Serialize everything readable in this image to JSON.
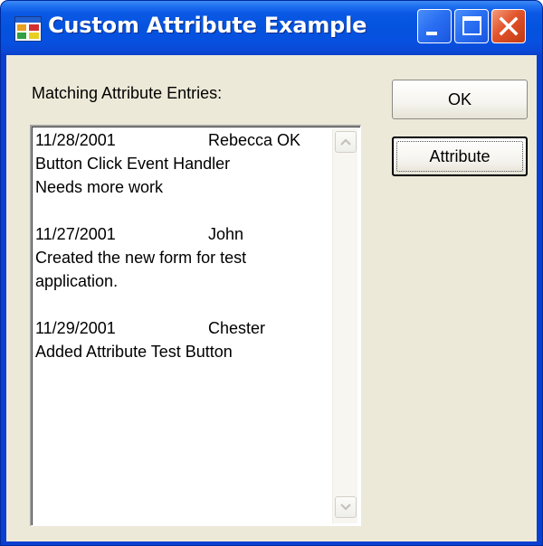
{
  "window": {
    "title": "Custom Attribute Example",
    "icon": "form-icon",
    "controls": {
      "minimize_icon": "minimize-icon",
      "maximize_icon": "maximize-icon",
      "close_icon": "close-icon"
    }
  },
  "form": {
    "label": "Matching Attribute Entries:",
    "entries": [
      {
        "date": "11/28/2001",
        "name": "Rebecca OK",
        "lines": [
          "Button Click Event Handler",
          "Needs more work"
        ]
      },
      {
        "date": "11/27/2001",
        "name": "John",
        "lines": [
          "Created the new form for test",
          "application."
        ]
      },
      {
        "date": "11/29/2001",
        "name": "Chester",
        "lines": [
          "Added Attribute Test Button"
        ]
      }
    ],
    "ok_label": "OK",
    "attribute_label": "Attribute"
  },
  "colors": {
    "titlebar": "#0453de",
    "client": "#ece9d8",
    "close_button": "#e2532a"
  }
}
